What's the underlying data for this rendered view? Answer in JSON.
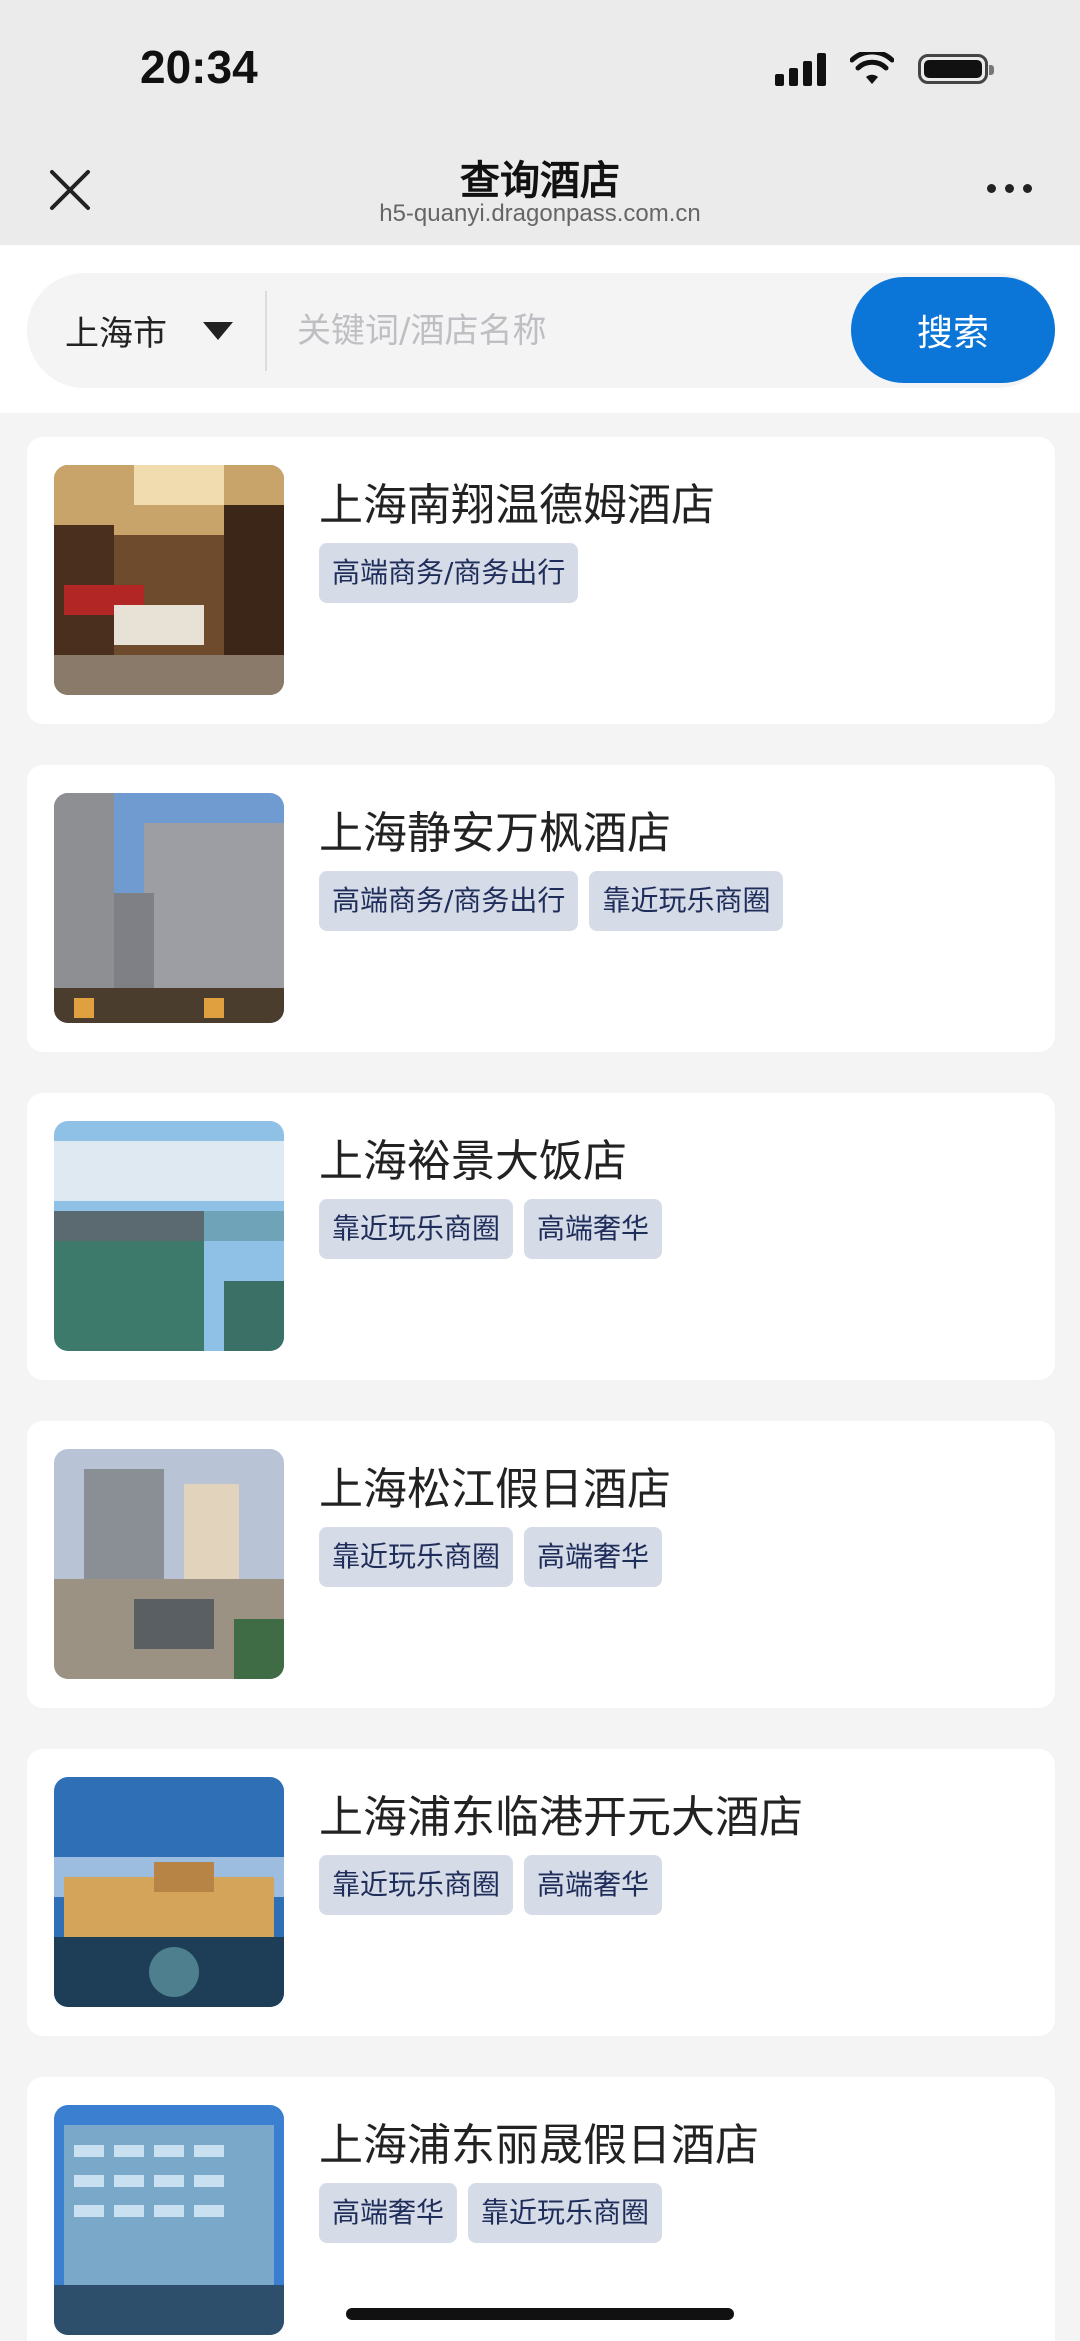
{
  "status_bar": {
    "time": "20:34"
  },
  "nav": {
    "title": "查询酒店",
    "url": "h5-quanyi.dragonpass.com.cn"
  },
  "search": {
    "city": "上海市",
    "placeholder": "关键词/酒店名称",
    "button_label": "搜索"
  },
  "hotels": [
    {
      "name": "上海南翔温德姆酒店",
      "tags": [
        "高端商务/商务出行"
      ]
    },
    {
      "name": "上海静安万枫酒店",
      "tags": [
        "高端商务/商务出行",
        "靠近玩乐商圈"
      ]
    },
    {
      "name": "上海裕景大饭店",
      "tags": [
        "靠近玩乐商圈",
        "高端奢华"
      ]
    },
    {
      "name": "上海松江假日酒店",
      "tags": [
        "靠近玩乐商圈",
        "高端奢华"
      ]
    },
    {
      "name": "上海浦东临港开元大酒店",
      "tags": [
        "靠近玩乐商圈",
        "高端奢华"
      ]
    },
    {
      "name": "上海浦东丽晟假日酒店",
      "tags": [
        "高端奢华",
        "靠近玩乐商圈"
      ]
    }
  ],
  "colors": {
    "accent": "#0b76d8",
    "tag_bg": "#d5dbe7",
    "tag_text": "#1f2d5a"
  }
}
